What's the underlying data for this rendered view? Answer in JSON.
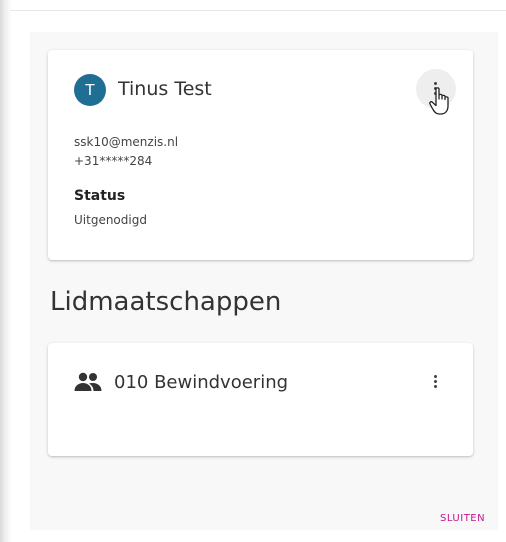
{
  "user_card": {
    "avatar_initial": "T",
    "name": "Tinus Test",
    "email": "ssk10@menzis.nl",
    "phone": "+31*****284",
    "status_label": "Status",
    "status_value": "Uitgenodigd"
  },
  "memberships": {
    "title": "Lidmaatschappen",
    "items": [
      {
        "name": "010 Bewindvoering",
        "icon": "group-icon"
      }
    ]
  },
  "footer": {
    "close_label": "SLUITEN"
  },
  "colors": {
    "avatar": "#1f6f95",
    "accent": "#c2188b"
  }
}
